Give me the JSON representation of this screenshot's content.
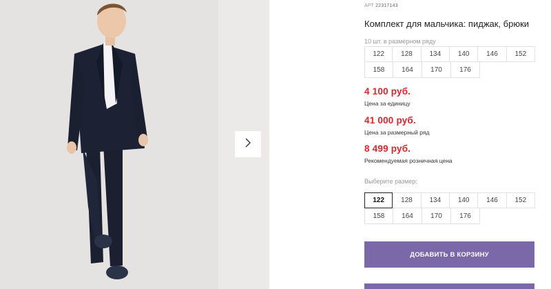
{
  "product": {
    "article_label": "АРТ",
    "article_number": "22317143",
    "title": "Комплект для мальчика: пиджак, брюки",
    "row_note": "10 шт. в размерном ряду",
    "sizes_row": [
      [
        "122",
        "128",
        "134",
        "140",
        "146",
        "152"
      ],
      [
        "158",
        "164",
        "170",
        "176"
      ]
    ],
    "prices": [
      {
        "value": "4 100 руб.",
        "label": "Цена за единицу"
      },
      {
        "value": "41 000 руб.",
        "label": "Цена за размерный ряд"
      },
      {
        "value": "8 499 руб.",
        "label": "Рекомендуемая розничная цена"
      }
    ],
    "choose_size_label": "Выберите размер:",
    "size_select": [
      [
        "122",
        "128",
        "134",
        "140",
        "146",
        "152"
      ],
      [
        "158",
        "164",
        "170",
        "176"
      ]
    ],
    "selected_size": "122",
    "add_to_cart": "ДОБАВИТЬ В КОРЗИНУ"
  },
  "gallery": {
    "next_icon": "chevron-right-icon"
  },
  "colors": {
    "price": "#e3242b",
    "button": "#7b68a8"
  }
}
